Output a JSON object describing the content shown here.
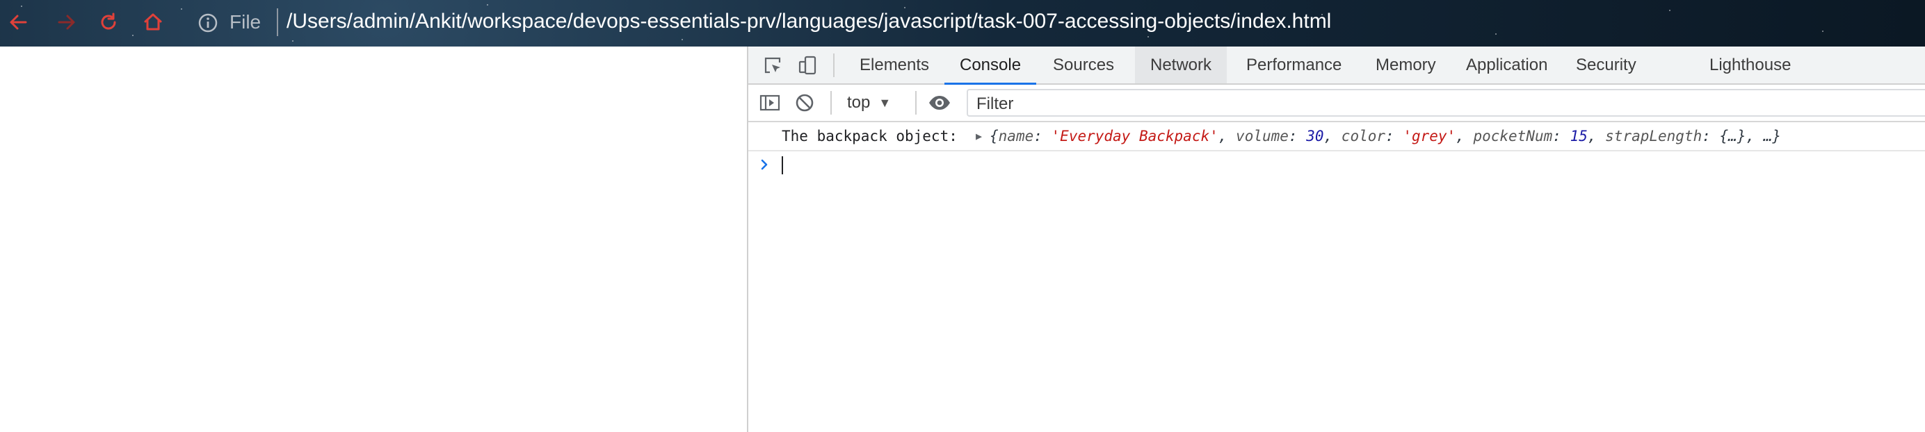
{
  "browser": {
    "scheme_label": "File",
    "url": "/Users/admin/Ankit/workspace/devops-essentials-prv/languages/javascript/task-007-accessing-objects/index.html",
    "nav_icons": [
      "back-arrow-icon",
      "forward-arrow-icon",
      "reload-icon",
      "home-icon",
      "info-icon"
    ],
    "nav_icon_color": "#e0413a"
  },
  "devtools": {
    "tabs": [
      {
        "label": "Elements"
      },
      {
        "label": "Console",
        "active": true
      },
      {
        "label": "Sources"
      },
      {
        "label": "Network",
        "hover": true
      },
      {
        "label": "Performance"
      },
      {
        "label": "Memory"
      },
      {
        "label": "Application"
      },
      {
        "label": "Security"
      },
      {
        "label": "Lighthouse"
      }
    ],
    "accent_color": "#1a73e8",
    "toolbar_icons": [
      "inspect-element-icon",
      "device-toolbar-icon"
    ],
    "console_toolbar": {
      "icons": [
        "show-sidebar-icon",
        "clear-console-icon",
        "live-expression-eye-icon"
      ],
      "context": "top",
      "filter_placeholder": "Filter"
    },
    "console": {
      "log_label": "The backpack object:",
      "object_preview": {
        "open": "{",
        "fields": [
          {
            "key": "name",
            "value": "'Everyday Backpack'",
            "kind": "string"
          },
          {
            "key": "volume",
            "value": "30",
            "kind": "number"
          },
          {
            "key": "color",
            "value": "'grey'",
            "kind": "string"
          },
          {
            "key": "pocketNum",
            "value": "15",
            "kind": "number"
          },
          {
            "key": "strapLength",
            "value": "{…}",
            "kind": "object"
          }
        ],
        "ellipsis": "…",
        "close": "}"
      }
    }
  }
}
